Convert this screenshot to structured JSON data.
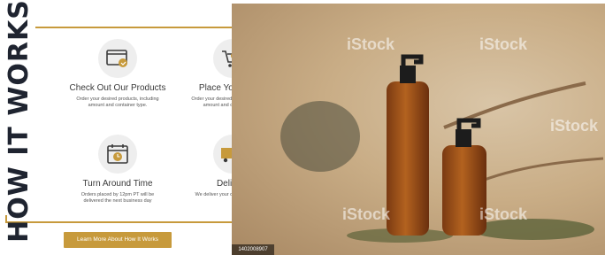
{
  "panel": {
    "vertical_title": "HOW IT WORKS",
    "steps": [
      {
        "icon": "browser-icon",
        "title": "Check Out Our Products",
        "desc": "Order your desired products, including amount and container type."
      },
      {
        "icon": "cart-icon",
        "title": "Place Your Order",
        "desc": "Order your desired products, including amount and container type."
      },
      {
        "icon": "calendar-clock-icon",
        "title": "Turn Around Time",
        "desc": "Orders placed by 12pm PT will be delivered the next business day"
      },
      {
        "icon": "truck-icon",
        "title": "Delivery",
        "desc": "We deliver your order to your door!"
      }
    ],
    "cta_label": "Learn More About How It Works"
  },
  "photo": {
    "watermark": "iStock",
    "stock_id": "1402008907"
  },
  "colors": {
    "accent": "#c79a3c",
    "title": "#1f2430",
    "icon_bg": "#eeeeee"
  }
}
